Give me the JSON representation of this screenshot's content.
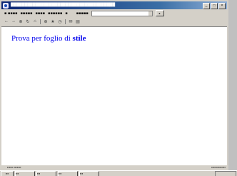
{
  "text": "Prova per foglio di ",
  "emphasis": "stile"
}
